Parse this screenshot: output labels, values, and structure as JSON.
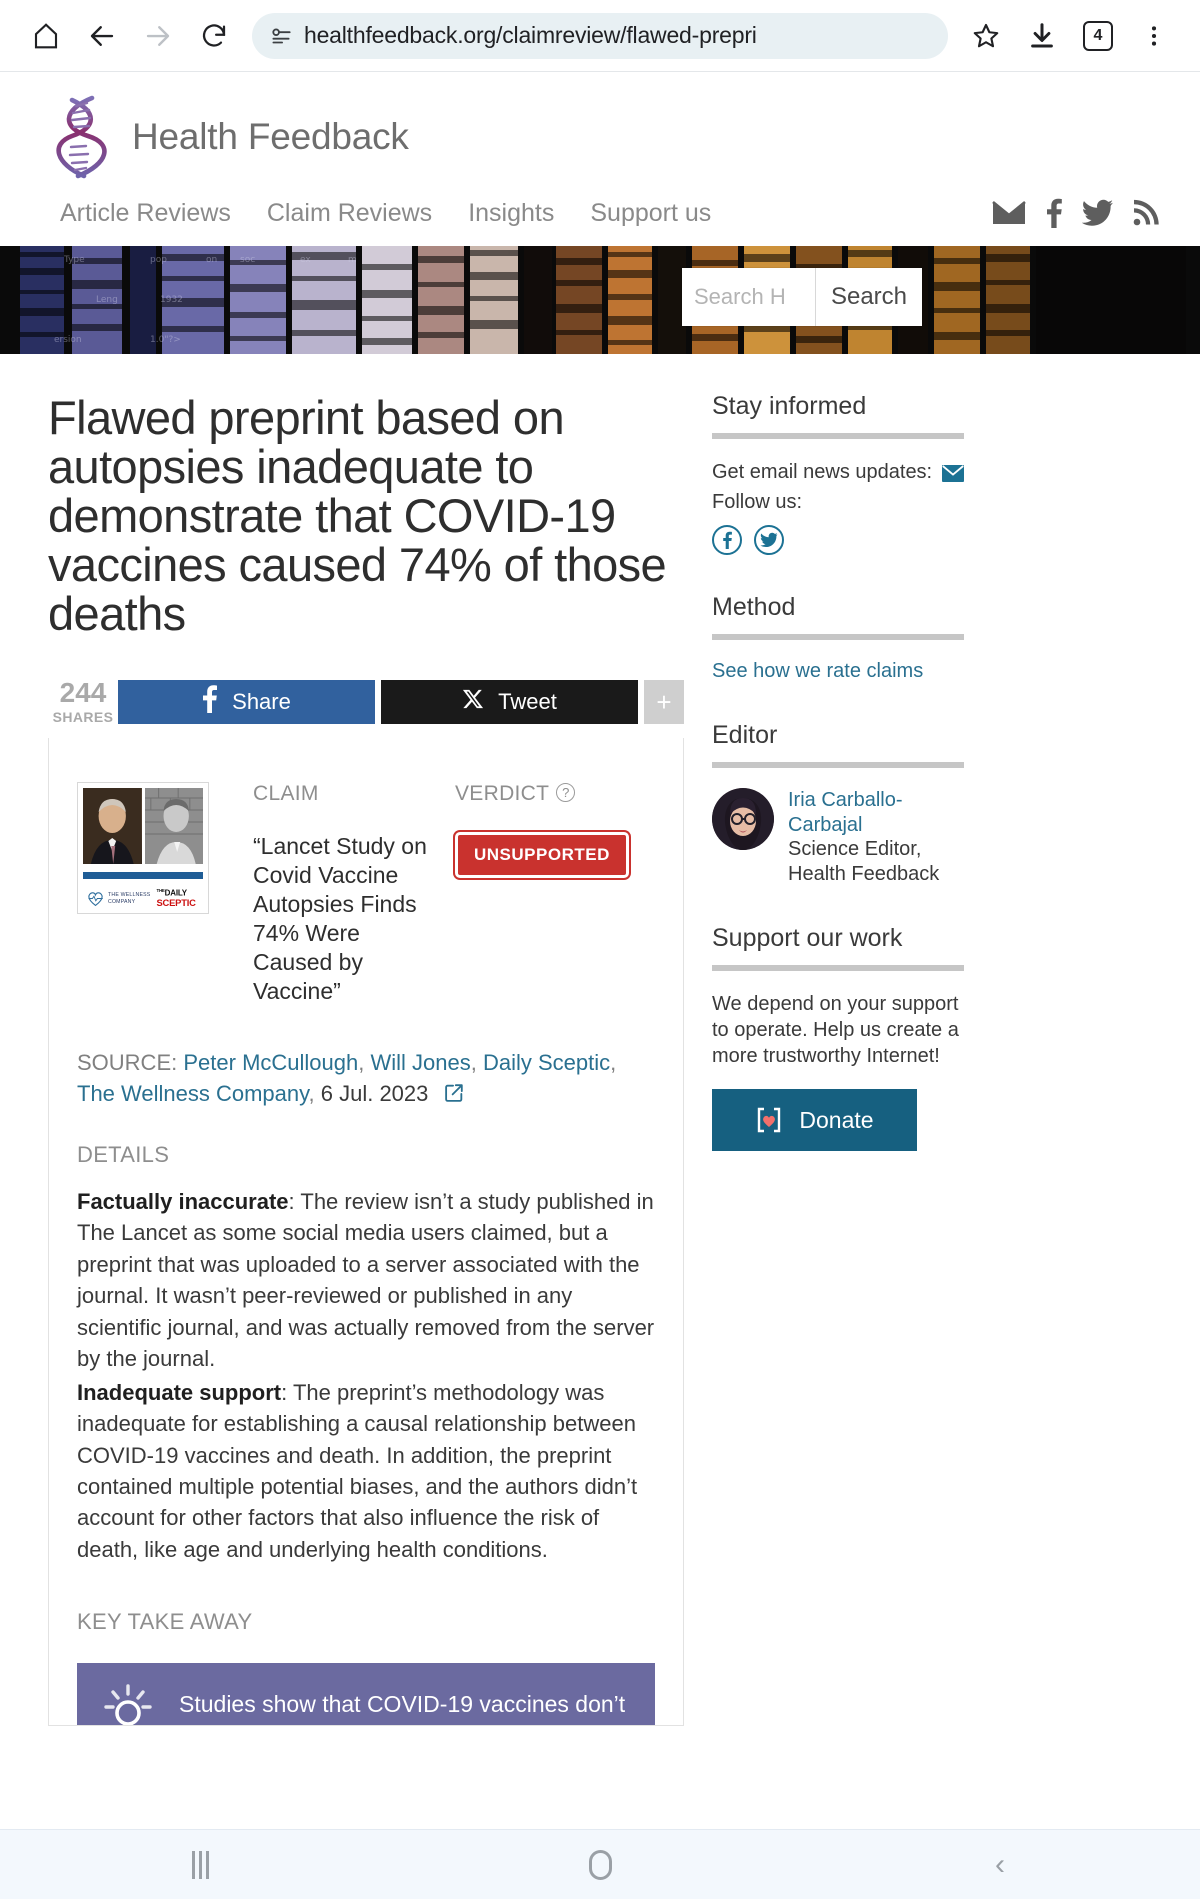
{
  "browser": {
    "url": "healthfeedback.org/claimreview/flawed-prepri",
    "tab_count": "4",
    "icons": {
      "home": "home-icon",
      "back": "back-arrow-icon",
      "forward": "forward-arrow-icon",
      "reload": "reload-icon",
      "site_info": "site-info-icon",
      "bookmark": "star-icon",
      "download": "download-icon",
      "menu": "overflow-menu-icon"
    }
  },
  "site": {
    "title": "Health Feedback",
    "nav": [
      {
        "label": "Article Reviews"
      },
      {
        "label": "Claim Reviews"
      },
      {
        "label": "Insights"
      },
      {
        "label": "Support us"
      }
    ],
    "social": [
      {
        "name": "email-icon",
        "glyph": "✉"
      },
      {
        "name": "facebook-icon",
        "glyph": "f"
      },
      {
        "name": "twitter-icon",
        "glyph": "🐦"
      },
      {
        "name": "rss-icon",
        "glyph": "☳"
      }
    ]
  },
  "search": {
    "placeholder": "Search H",
    "button_label": "Search"
  },
  "article": {
    "headline": "Flawed preprint based on autopsies inadequate to demonstrate that COVID-19 vaccines caused 74% of those deaths",
    "share": {
      "count": "244",
      "count_label": "SHARES",
      "facebook_label": "Share",
      "twitter_label": "Tweet",
      "more_label": "+"
    },
    "claim": {
      "label": "CLAIM",
      "text": "“Lancet Study on Covid Vaccine Autopsies Finds 74% Were Caused by Vaccine”"
    },
    "verdict": {
      "label": "VERDICT",
      "help_glyph": "?",
      "badge": "UNSUPPORTED",
      "badge_color": "#c9322e"
    },
    "source": {
      "label": "SOURCE:",
      "authors": [
        {
          "name": "Peter McCullough"
        },
        {
          "name": "Will Jones"
        },
        {
          "name": "Daily Sceptic"
        },
        {
          "name": "The Wellness Company"
        }
      ],
      "date": "6 Jul. 2023",
      "external_icon": "external-link-icon"
    },
    "details": {
      "label": "DETAILS",
      "paragraphs": [
        {
          "lead": "Factually inaccurate",
          "body": ": The review isn’t a study published in The Lancet as some social media users claimed, but a preprint that was uploaded to a server associated with the journal. It wasn’t peer-reviewed or published in any scientific journal, and was actually removed from the server by the journal."
        },
        {
          "lead": "Inadequate support",
          "body": ": The preprint’s methodology was inadequate for establishing a causal relationship between COVID-19 vaccines and death. In addition, the preprint contained multiple potential biases, and the authors didn’t account for other factors that also influence the risk of death, like age and underlying health conditions."
        }
      ]
    },
    "key_takeaway": {
      "label": "KEY TAKE AWAY",
      "text": "Studies show that COVID-19 vaccines don’t",
      "banner_color": "#6b6aa0",
      "icon": "lightbulb-icon"
    },
    "thumbnail": {
      "wellness_logo_line1": "THE WELLNESS",
      "wellness_logo_line2": "COMPANY",
      "sceptic_logo_prefix": "THE",
      "sceptic_logo_line1": "DAILY",
      "sceptic_logo_line2": "SCEPTIC"
    }
  },
  "sidebar": {
    "stay_informed": {
      "heading": "Stay informed",
      "email_text": "Get email news updates:",
      "email_icon": "envelope-icon",
      "follow_text": "Follow us:",
      "icons": [
        {
          "name": "facebook-circle-icon",
          "glyph": "f"
        },
        {
          "name": "twitter-circle-icon",
          "glyph": "🐦"
        }
      ]
    },
    "method": {
      "heading": "Method",
      "link": "See how we rate claims"
    },
    "editor": {
      "heading": "Editor",
      "name": "Iria Carballo-Carbajal",
      "role": "Science Editor, Health Feedback"
    },
    "support": {
      "heading": "Support our work",
      "body": "We depend on your support to operate. Help us create a more trustworthy Internet!",
      "donate_label": "Donate",
      "donate_color": "#166080"
    }
  },
  "android_nav": {
    "recents": "recents-button",
    "home": "home-button",
    "back": "back-button",
    "back_glyph": "‹"
  }
}
